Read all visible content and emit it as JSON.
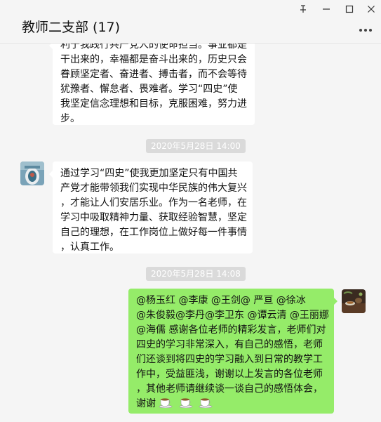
{
  "window": {
    "title": "教师二支部 (17)",
    "pin_glyph": "Ԅ",
    "minimize_glyph": "—",
    "maximize_glyph": "☐",
    "close_glyph": "✕",
    "more_glyph": "…"
  },
  "messages": [
    {
      "lines": [
        "利于我践行共产党人的使命担当。事业都是",
        "干出来的，幸福都是奋斗出来的，历史只会",
        "眷顾坚定者、奋进者、搏击者，而不会等待",
        "犹豫者、懈怠者、畏难者。学习“四史”使",
        "我坚定信念理想和目标，克服困难，努力进",
        "步。"
      ]
    },
    {
      "timestamp": "2020年5月28日 14:00",
      "lines": [
        "通过学习“四史”使我更加坚定只有中国共",
        "产党才能带领我们实现中华民族的伟大复兴",
        "，才能让人们安居乐业。作为一名老师，在",
        "学习中吸取精神力量、获取经验智慧，坚定",
        "自己的理想，在工作岗位上做好每一件事情",
        "，认真工作。"
      ]
    },
    {
      "timestamp": "2020年5月28日 14:08",
      "lines": [
        "@杨玉红 @李康 @王剑@      严亘 @徐冰",
        "@朱俊毅@李丹@李卫东 @谭云清 @王丽娜",
        "@海儒 感谢各位老师的精彩发言，老师们对",
        "四史的学习非常深入，有自己的感悟，老师",
        "们还谈到将四史的学习融入到日常的教学工",
        "作中，受益匪浅，谢谢以上发言的各位老师",
        "，其他老师请继续谈一谈自己的感悟体会，"
      ],
      "last_line_text": "谢谢",
      "emoji": [
        "coffee-emoji",
        "coffee-emoji",
        "coffee-emoji"
      ]
    }
  ],
  "colors": {
    "background": "#f5f5f5",
    "incoming_bubble": "#ffffff",
    "outgoing_bubble": "#95ec69",
    "timestamp_bg": "#dadada"
  }
}
